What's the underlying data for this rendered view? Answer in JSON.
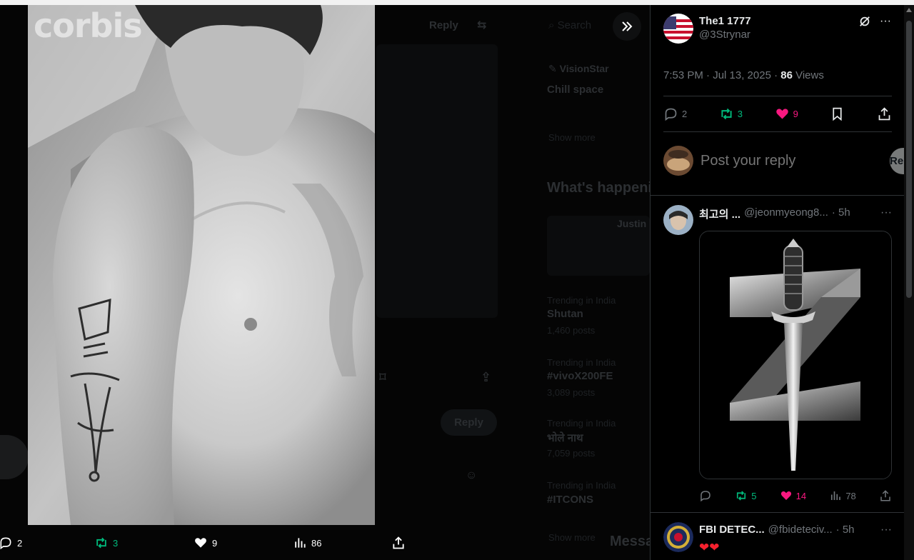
{
  "background": {
    "reply_label": "Reply",
    "search_label": "Search",
    "post_author": "VisionStar",
    "post_text": "Chill space",
    "show_more": "Show more",
    "whats_happening": "What's happening",
    "person_name": "Justin",
    "trends": [
      {
        "context": "Trending in India",
        "title": "Shutan",
        "count": "1,460 posts"
      },
      {
        "context": "Trending in India",
        "title": "#vivoX200FE",
        "count": "3,089 posts"
      },
      {
        "context": "Trending in India",
        "title": "भोले नाथ",
        "count": "7,059 posts"
      },
      {
        "context": "Trending in India",
        "title": "#ITCONS",
        "count": ""
      }
    ],
    "show_more_2": "Show more",
    "reply_pill": "Reply",
    "messages": "Messages"
  },
  "photo": {
    "watermark": "corbis"
  },
  "media_bar": {
    "replies": "2",
    "reposts": "3",
    "likes": "9",
    "views": "86"
  },
  "post": {
    "author_name": "The1 1777",
    "author_handle": "@3Strynar",
    "timestamp": "7:53 PM · Jul 13, 2025 · ",
    "views_count": "86",
    "views_label": " Views",
    "replies": "2",
    "reposts": "3",
    "likes": "9"
  },
  "reply_box": {
    "placeholder": "Post your reply",
    "button": "Reply"
  },
  "replies": [
    {
      "name": "최고의 ...",
      "handle": "@jeonmyeong8...",
      "time": "· 5h",
      "reposts": "5",
      "likes": "14",
      "views": "78"
    },
    {
      "name": "FBI DETEC...",
      "handle": "@fbideteciv...",
      "time": "· 5h",
      "text": "❤❤"
    }
  ],
  "colors": {
    "accent_green": "#00ba7c",
    "accent_pink": "#f91880",
    "muted": "#71767b",
    "border": "#2f3336"
  }
}
